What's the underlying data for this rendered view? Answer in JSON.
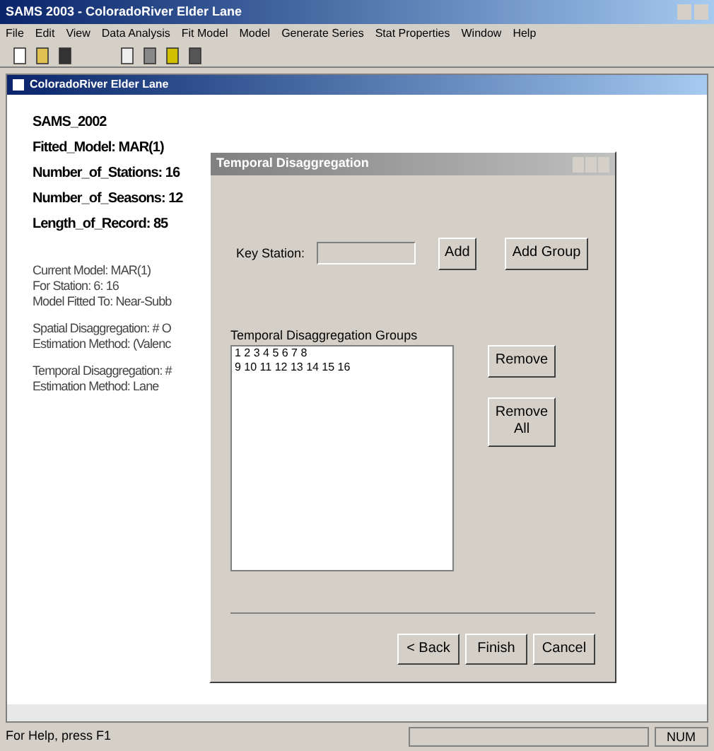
{
  "window": {
    "title": "SAMS 2003 - ColoradoRiver Elder Lane"
  },
  "menu": [
    "File",
    "Edit",
    "View",
    "Data Analysis",
    "Fit Model",
    "Model",
    "Generate Series",
    "Stat Properties",
    "Window",
    "Help"
  ],
  "child_window": {
    "title": "ColoradoRiver Elder Lane"
  },
  "summary": {
    "header_lines": [
      "SAMS_2002",
      "Fitted_Model: MAR(1)",
      "Number_of_Stations: 16",
      "Number_of_Seasons: 12",
      "Length_of_Record: 85"
    ],
    "groups": [
      [
        "Current Model:  MAR(1)",
        "For Station: 6: 16",
        "Model Fitted To: Near-Subb"
      ],
      [
        "Spatial Disaggregation:  # O",
        "Estimation Method:  (Valenc"
      ],
      [
        "Temporal Disaggregation:  #",
        "Estimation Method:  Lane"
      ]
    ]
  },
  "dialog": {
    "title": "Temporal Disaggregation",
    "key_station_label": "Key Station:",
    "add": "Add",
    "add_group": "Add Group",
    "groups_label": "Temporal Disaggregation Groups",
    "groups": [
      "1 2 3 4 5 6 7 8",
      "9 10 11 12 13 14 15 16"
    ],
    "remove": "Remove",
    "remove_all": "Remove All",
    "buttons": [
      "< Back",
      "Finish",
      "Cancel"
    ]
  },
  "status_bar": {
    "text": "For Help, press F1",
    "indicator": "NUM"
  }
}
